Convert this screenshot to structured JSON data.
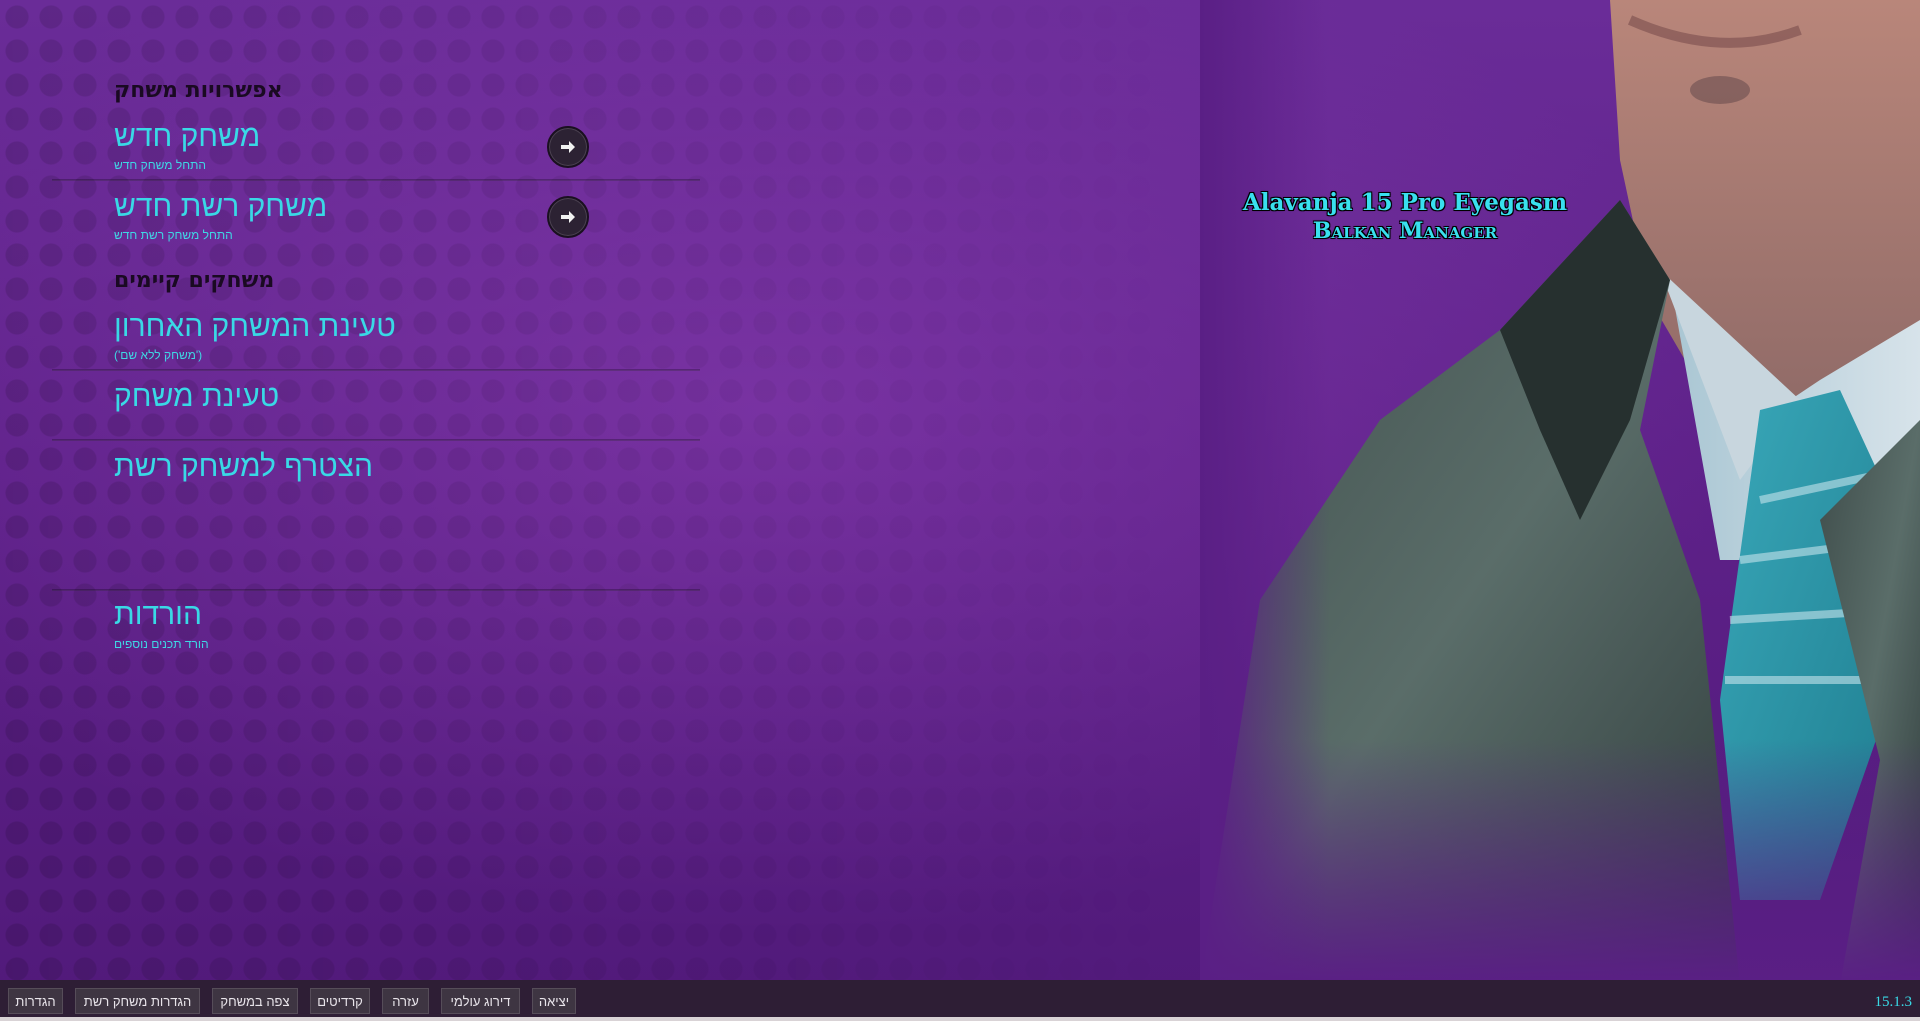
{
  "menu": {
    "section_game_options": "אפשרויות משחק",
    "new_game": {
      "label": "משחק חדש",
      "sub": "התחל משחק חדש"
    },
    "new_network_game": {
      "label": "משחק רשת חדש",
      "sub": "התחל משחק רשת חדש"
    },
    "section_existing_games": "משחקים קיימים",
    "load_last_game": {
      "label": "טעינת המשחק האחרון",
      "sub": "('משחק ללא שם')"
    },
    "load_game": {
      "label": "טעינת משחק"
    },
    "join_network_game": {
      "label": "הצטרף למשחק רשת"
    },
    "downloads": {
      "label": "הורדות",
      "sub": "הורד תכנים נוספים"
    }
  },
  "logo": {
    "line1": "Alavanja 15 Pro Eyegasm",
    "line2": "Balkan Manager"
  },
  "bottom_bar": {
    "settings": "הגדרות",
    "network_settings": "הגדרות משחק רשת",
    "watch_game": "צפה במשחק",
    "credits": "קרדיטים",
    "help": "עזרה",
    "world_ranking": "דירוג עולמי",
    "exit": "יציאה",
    "version": "15.1.3"
  },
  "colors": {
    "accent": "#39d9e6",
    "background": "#5e2189",
    "bar": "#2e1e35"
  },
  "icons": {
    "arrow": "arrow-right-icon"
  }
}
